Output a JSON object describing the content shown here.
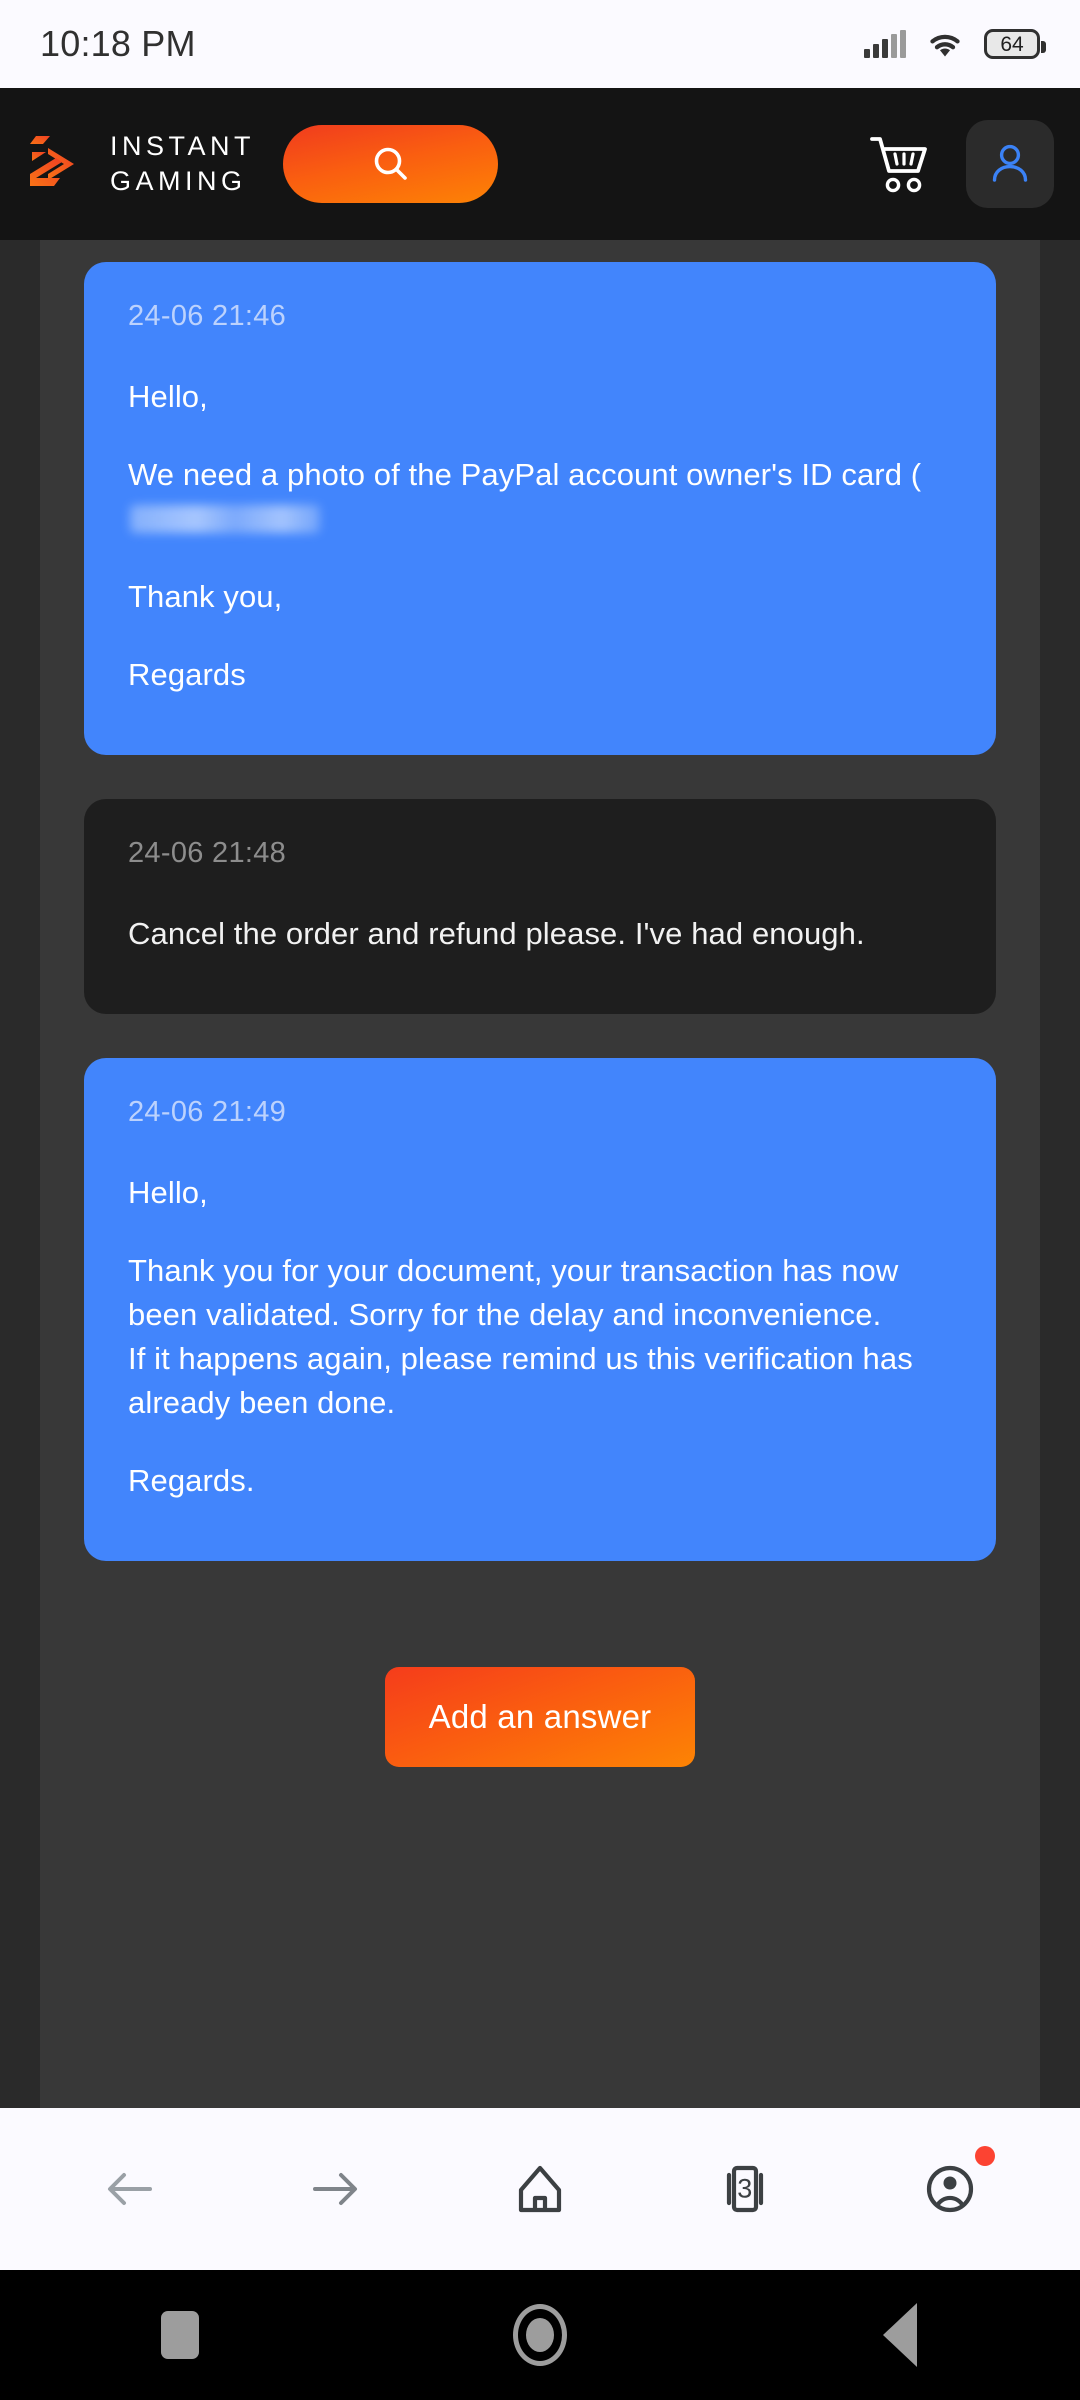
{
  "status_bar": {
    "time": "10:18 PM",
    "battery_level": "64",
    "signal_icon": "cellular-signal-icon",
    "wifi_icon": "wifi-icon",
    "battery_icon": "battery-icon"
  },
  "app_header": {
    "brand_line1": "INSTANT",
    "brand_line2": "GAMING",
    "logo_icon": "instant-gaming-logo-icon",
    "search_icon": "search-icon",
    "cart_icon": "shopping-cart-icon",
    "account_icon": "account-person-icon",
    "background_color": "#141414",
    "accent_color": "#fa5f10",
    "account_icon_color": "#3b82f6"
  },
  "thread": {
    "messages": [
      {
        "sender": "agent",
        "timestamp": "24-06 21:46",
        "paragraphs": [
          "Hello,",
          "We need a photo of the PayPal account owner's ID card (",
          "Thank you,",
          "Regards"
        ],
        "has_redaction": true,
        "bubble_color": "#4285fc"
      },
      {
        "sender": "user",
        "timestamp": "24-06 21:48",
        "paragraphs": [
          "Cancel the order and refund please. I've had enough."
        ],
        "has_redaction": false,
        "bubble_color": "#1e1e1e"
      },
      {
        "sender": "agent",
        "timestamp": "24-06 21:49",
        "paragraphs": [
          "Hello,",
          "Thank you for your document, your transaction has now been validated. Sorry for the delay and inconvenience.",
          "If it happens again, please remind us this verification has already been done.",
          "Regards."
        ],
        "has_redaction": false,
        "bubble_color": "#4285fc"
      }
    ],
    "add_answer_label": "Add an answer"
  },
  "browser_bar": {
    "back_icon": "arrow-back-icon",
    "forward_icon": "arrow-forward-icon",
    "home_icon": "home-icon",
    "tabs_icon": "browser-tabs-icon",
    "tab_count": "3",
    "profile_icon": "profile-icon",
    "notification_dot_color": "#fc4332"
  },
  "system_nav": {
    "recents_icon": "recents-square-icon",
    "home_icon": "home-circle-icon",
    "back_icon": "back-triangle-icon"
  }
}
